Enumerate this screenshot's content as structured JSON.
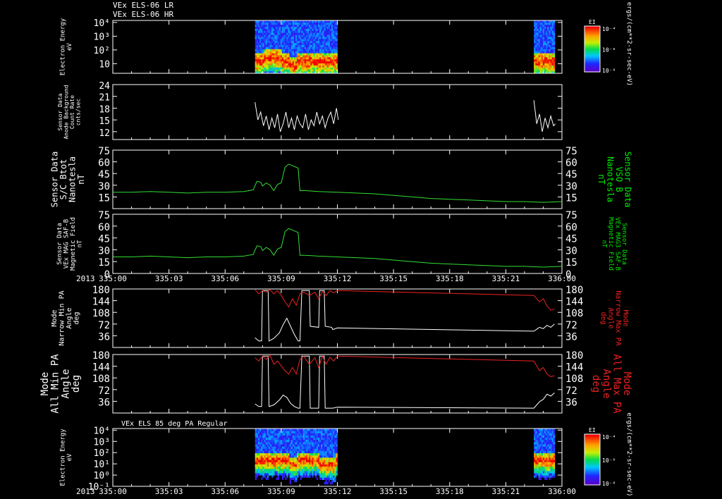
{
  "header": {
    "line1": "VEx ELS-06 LR",
    "line2": "VEx ELS-06 HR"
  },
  "time_axis": {
    "year_label": "2013",
    "ticks": [
      "335:00",
      "335:03",
      "335:06",
      "335:09",
      "335:12",
      "335:15",
      "335:18",
      "335:21",
      "336:00"
    ],
    "tick_minutes": [
      0,
      3,
      6,
      9,
      12,
      15,
      18,
      21,
      24
    ]
  },
  "colors": {
    "background": "#000000",
    "frame": "#ffffff",
    "mag_trace": "#33dd33",
    "max_pa_trace": "#ee2222",
    "min_pa_trace": "#ffffff",
    "secondary_green_label": "#00ee00",
    "secondary_red_label": "#ee2222"
  },
  "chart_data": [
    {
      "id": "els-energy-spectrogram",
      "type": "heatmap",
      "ylabel": [
        "Electron Energy",
        "eV"
      ],
      "y_scale": "log",
      "ytick_labels": [
        "10",
        "10²",
        "10³",
        "10⁴"
      ],
      "ytick_values": [
        10,
        100,
        1000,
        10000
      ],
      "colorbar": {
        "title": "EI",
        "tick_labels": [
          "10⁻⁴",
          "10⁻⁶",
          "10⁻⁸"
        ],
        "units_label": "ergs/(cm**2-sr-sec-eV)"
      },
      "data_intervals_minutes": [
        [
          7.6,
          12.0
        ],
        [
          22.5,
          23.6
        ]
      ]
    },
    {
      "id": "anode-background",
      "type": "line",
      "ylabel": [
        "Sensor Data",
        "Anode Background",
        "Count Rate",
        "cnts/sec"
      ],
      "ylim": [
        10,
        24
      ],
      "yticks": [
        12,
        15,
        18,
        21,
        24
      ],
      "series": [
        {
          "x_minutes": [
            7.6,
            7.75,
            7.9,
            8.05,
            8.2,
            8.35,
            8.5,
            8.65,
            8.8,
            8.95,
            9.1,
            9.25,
            9.4,
            9.55,
            9.7,
            9.85,
            10.0,
            10.15,
            10.3,
            10.45,
            10.6,
            10.75,
            10.9,
            11.05,
            11.2,
            11.35,
            11.5,
            11.65,
            11.8,
            11.95,
            12.05
          ],
          "values": [
            19.5,
            15,
            17,
            13.5,
            16,
            12.5,
            15.5,
            13,
            16.5,
            12,
            14,
            17,
            13,
            15.5,
            12.5,
            16,
            14,
            13,
            16.5,
            12.5,
            15,
            13.5,
            17,
            14,
            16,
            13,
            15.5,
            17,
            14,
            18,
            15
          ]
        },
        {
          "x_minutes": [
            22.5,
            22.65,
            22.8,
            22.95,
            23.1,
            23.25,
            23.4,
            23.55,
            23.65
          ],
          "values": [
            20,
            14,
            16.5,
            12,
            15.5,
            13,
            16,
            13.5,
            14
          ]
        }
      ]
    },
    {
      "id": "sc-btot",
      "type": "line",
      "ylabel": [
        "Sensor Data",
        "S/C Btot",
        "Nanotesla",
        "nT"
      ],
      "right_ylabel": [
        "Sensor Data",
        "VSO B",
        "Nanotesla",
        "nT"
      ],
      "ylim": [
        0,
        75
      ],
      "yticks": [
        15,
        30,
        45,
        60,
        75
      ],
      "series": [
        {
          "x_minutes": [
            0,
            1,
            2,
            3,
            4,
            5,
            6,
            7,
            7.5,
            7.7,
            7.9,
            8.0,
            8.2,
            8.4,
            8.6,
            8.8,
            9.0,
            9.2,
            9.4,
            9.6,
            9.9,
            10.0,
            10.3,
            11,
            12,
            13,
            14,
            15,
            16,
            17,
            18,
            19,
            20,
            21,
            22,
            23,
            24
          ],
          "values": [
            21,
            21,
            22,
            21,
            20,
            21,
            21,
            22,
            24,
            35,
            34,
            29,
            33,
            30,
            23,
            31,
            33,
            53,
            57,
            55,
            52,
            23,
            23,
            22,
            21,
            20,
            19,
            17,
            15,
            13,
            12,
            11,
            10,
            9,
            9,
            8,
            9
          ]
        }
      ]
    },
    {
      "id": "vex-mag-saf-b",
      "type": "line",
      "ylabel": [
        "Sensor Data",
        "VEx MAG SAF-B",
        "Magnetic Field",
        "nT"
      ],
      "right_ylabel": [
        "Sensor Data",
        "VEx MAG3 SAF-B",
        "Magnetic Field",
        "nT"
      ],
      "ylim": [
        0,
        75
      ],
      "yticks": [
        0,
        15,
        30,
        45,
        60,
        75
      ],
      "series": [
        {
          "x_minutes": [
            0,
            1,
            2,
            3,
            4,
            5,
            6,
            7,
            7.5,
            7.7,
            7.9,
            8.0,
            8.2,
            8.4,
            8.6,
            8.8,
            9.0,
            9.2,
            9.4,
            9.6,
            9.9,
            10.0,
            10.3,
            11,
            12,
            13,
            14,
            15,
            16,
            17,
            18,
            19,
            20,
            21,
            22,
            23,
            24
          ],
          "values": [
            21,
            21,
            22,
            21,
            20,
            21,
            21,
            22,
            24,
            35,
            34,
            29,
            33,
            30,
            23,
            31,
            33,
            53,
            57,
            55,
            52,
            23,
            23,
            22,
            21,
            20,
            19,
            17,
            15,
            13,
            12,
            11,
            10,
            9,
            9,
            8,
            9
          ]
        }
      ]
    },
    {
      "id": "narrow-pa",
      "type": "line",
      "ylabel": [
        "Mode",
        "Narrow Min PA",
        "Angle",
        "deg"
      ],
      "right_ylabel": [
        "Mode",
        "Narrow Max PA",
        "Angle",
        "deg"
      ],
      "ylim": [
        0,
        180
      ],
      "yticks": [
        36,
        72,
        108,
        144,
        180
      ],
      "series": [
        {
          "name": "Min PA",
          "x_minutes": [
            7.6,
            7.8,
            7.95,
            8.0,
            8.3,
            8.35,
            8.6,
            8.9,
            9.1,
            9.3,
            9.5,
            9.7,
            9.9,
            10.0,
            10.1,
            10.5,
            10.55,
            11.0,
            11.05,
            11.3,
            11.35,
            11.7,
            11.75,
            12.0,
            22.5,
            22.8,
            23.0,
            23.2,
            23.4,
            23.6
          ],
          "values": [
            30,
            20,
            20,
            175,
            175,
            20,
            28,
            45,
            70,
            90,
            65,
            40,
            20,
            20,
            175,
            175,
            65,
            62,
            175,
            175,
            65,
            62,
            55,
            60,
            50,
            62,
            58,
            68,
            62,
            72
          ]
        },
        {
          "name": "Max PA",
          "x_minutes": [
            7.6,
            7.8,
            8.0,
            8.2,
            8.4,
            8.6,
            8.8,
            9.0,
            9.2,
            9.4,
            9.6,
            9.8,
            10.0,
            10.2,
            10.5,
            10.8,
            11.0,
            11.2,
            11.4,
            11.6,
            11.8,
            12.0,
            22.5,
            22.8,
            23.0,
            23.2,
            23.4,
            23.6
          ],
          "values": [
            178,
            165,
            175,
            170,
            178,
            165,
            175,
            160,
            140,
            125,
            150,
            130,
            165,
            170,
            160,
            170,
            150,
            172,
            160,
            175,
            168,
            175,
            160,
            140,
            150,
            128,
            115,
            118
          ]
        }
      ]
    },
    {
      "id": "all-pa",
      "type": "line",
      "ylabel": [
        "Mode",
        "All Min PA",
        "Angle",
        "deg"
      ],
      "right_ylabel": [
        "Mode",
        "All Max PA",
        "Angle",
        "deg"
      ],
      "ylim": [
        0,
        180
      ],
      "yticks": [
        36,
        72,
        108,
        144,
        180
      ],
      "series": [
        {
          "name": "Min PA",
          "x_minutes": [
            7.6,
            7.8,
            7.95,
            8.0,
            8.3,
            8.35,
            8.6,
            8.9,
            9.1,
            9.3,
            9.5,
            9.7,
            9.9,
            10.0,
            10.1,
            10.5,
            10.55,
            11.0,
            11.05,
            11.3,
            11.35,
            11.7,
            11.75,
            12.0,
            22.5,
            22.8,
            23.0,
            23.2,
            23.4,
            23.6
          ],
          "values": [
            28,
            20,
            20,
            175,
            175,
            20,
            25,
            40,
            55,
            48,
            30,
            20,
            15,
            15,
            175,
            175,
            15,
            15,
            175,
            175,
            15,
            15,
            15,
            18,
            15,
            35,
            42,
            58,
            52,
            62
          ]
        },
        {
          "name": "Max PA",
          "x_minutes": [
            7.6,
            7.8,
            8.0,
            8.2,
            8.4,
            8.6,
            8.8,
            9.0,
            9.2,
            9.4,
            9.6,
            9.8,
            10.0,
            10.2,
            10.5,
            10.8,
            11.0,
            11.2,
            11.4,
            11.6,
            11.8,
            12.0,
            22.5,
            22.8,
            23.0,
            23.2,
            23.4,
            23.6
          ],
          "values": [
            170,
            160,
            175,
            165,
            178,
            150,
            160,
            145,
            130,
            120,
            140,
            120,
            165,
            175,
            150,
            170,
            140,
            175,
            150,
            172,
            160,
            175,
            160,
            130,
            140,
            120,
            112,
            115
          ]
        }
      ]
    },
    {
      "id": "els-85deg-spectrogram",
      "type": "heatmap",
      "title": "VEx ELS 85 deg PA Regular",
      "ylabel": [
        "Electron Energy",
        "eV"
      ],
      "y_scale": "log",
      "ytick_labels": [
        "10⁻¹",
        "10⁰",
        "10¹",
        "10²",
        "10³",
        "10⁴"
      ],
      "ytick_values": [
        0.1,
        1,
        10,
        100,
        1000,
        10000
      ],
      "colorbar": {
        "title": "EI",
        "tick_labels": [
          "10⁻⁴",
          "10⁻⁶",
          "10⁻⁸"
        ],
        "units_label": "ergs/(cm**2-sr-sec-eV)"
      },
      "data_intervals_minutes": [
        [
          7.6,
          12.0
        ],
        [
          22.5,
          23.6
        ]
      ]
    }
  ]
}
